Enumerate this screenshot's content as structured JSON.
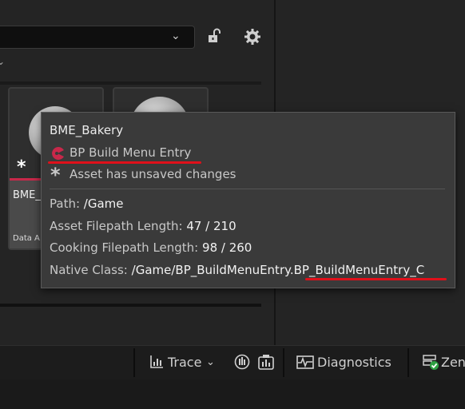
{
  "filter": {
    "dropdown_icon": "chevron-down-icon"
  },
  "toolbar": {
    "lock_icon": "lock-open-icon",
    "settings_icon": "gear-icon"
  },
  "assets": [
    {
      "name": "BME_",
      "type": "Data A",
      "unsaved_marker": "*",
      "accent_color": "#c8284a"
    },
    {
      "name": "",
      "type": ""
    }
  ],
  "tooltip": {
    "title": "BME_Bakery",
    "class_name": "BP Build Menu Entry",
    "class_icon": "blueprint-pie-icon",
    "unsaved_marker": "*",
    "unsaved_text": "Asset has unsaved changes",
    "path_label": "Path:",
    "path_value": "/Game",
    "asset_len_label": "Asset Filepath Length:",
    "asset_len_value": "47 / 210",
    "cook_len_label": "Cooking Filepath Length:",
    "cook_len_value": "98 / 260",
    "native_label": "Native Class:",
    "native_value": "/Game/BP_BuildMenuEntry.BP_BuildMenuEntry_C",
    "highlight_color": "#e0101a"
  },
  "statusbar": {
    "trace_label": "Trace",
    "diagnostics_label": "Diagnostics",
    "zen_label": "Zen"
  }
}
